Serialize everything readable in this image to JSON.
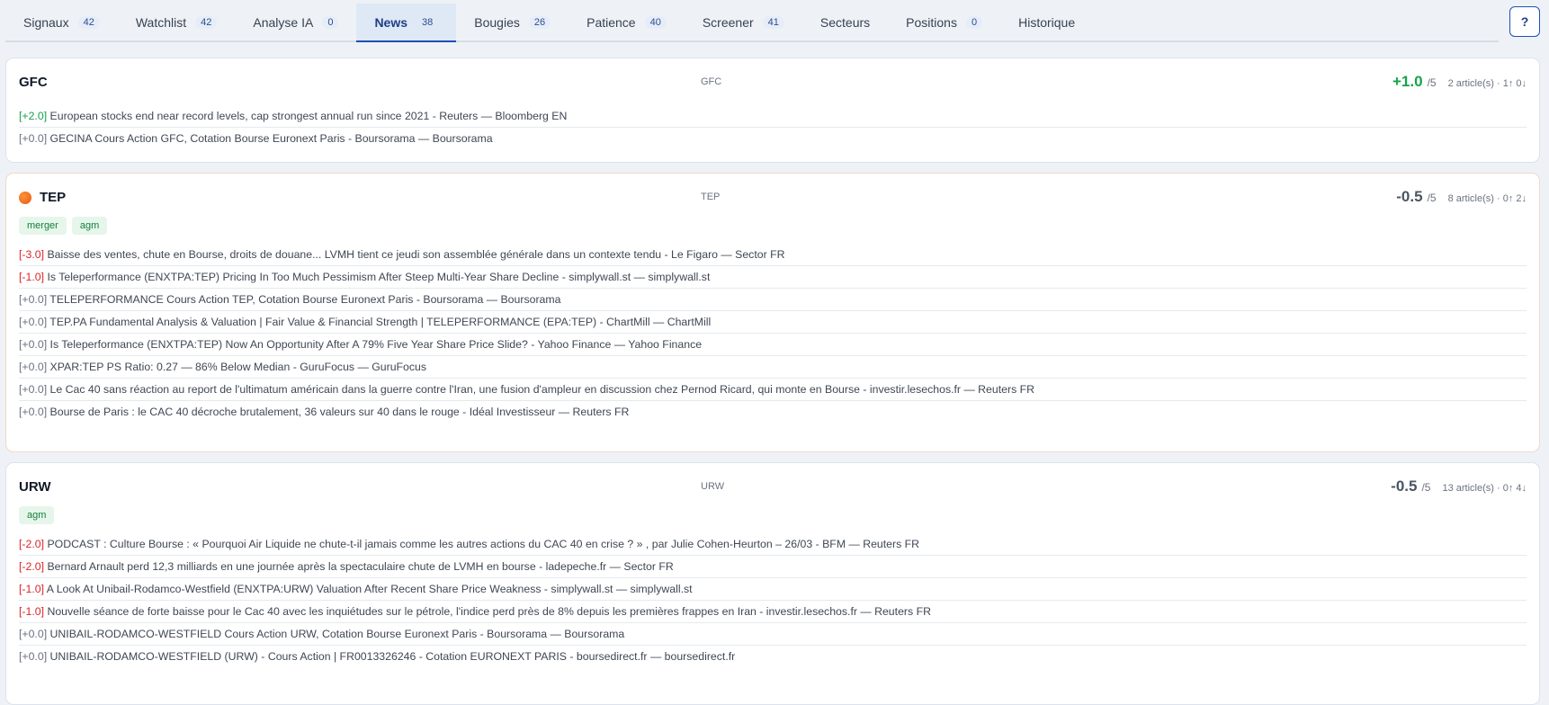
{
  "tabs": [
    {
      "label": "Signaux",
      "badge": "42"
    },
    {
      "label": "Watchlist",
      "badge": "42"
    },
    {
      "label": "Analyse IA",
      "badge": "0"
    },
    {
      "label": "News",
      "badge": "38"
    },
    {
      "label": "Bougies",
      "badge": "26"
    },
    {
      "label": "Patience",
      "badge": "40"
    },
    {
      "label": "Screener",
      "badge": "41"
    },
    {
      "label": "Secteurs",
      "badge": ""
    },
    {
      "label": "Positions",
      "badge": "0"
    },
    {
      "label": "Historique",
      "badge": ""
    }
  ],
  "active_tab": "News",
  "help_label": "?",
  "cards": [
    {
      "ticker": "GFC",
      "center": "GFC",
      "score": "+1.0",
      "score_max": "/5",
      "meta": "2 article(s) · 1↑ 0↓",
      "tags": [],
      "news": [
        {
          "score": "[+2.0]",
          "text": " European stocks end near record levels, cap strongest annual run since 2021 - Reuters — Bloomberg EN"
        },
        {
          "score": "[+0.0]",
          "text": " GECINA Cours Action GFC, Cotation Bourse Euronext Paris - Boursorama — Boursorama"
        }
      ]
    },
    {
      "ticker": "TEP",
      "center": "TEP",
      "score": "-0.5",
      "score_max": "/5",
      "meta": "8 article(s) · 0↑ 2↓",
      "tags": [
        "merger",
        "agm"
      ],
      "news": [
        {
          "score": "[-3.0]",
          "text": " Baisse des ventes, chute en Bourse, droits de douane... LVMH tient ce jeudi son assemblée générale dans un contexte tendu - Le Figaro — Sector FR"
        },
        {
          "score": "[-1.0]",
          "text": " Is Teleperformance (ENXTPA:TEP) Pricing In Too Much Pessimism After Steep Multi-Year Share Decline - simplywall.st — simplywall.st"
        },
        {
          "score": "[+0.0]",
          "text": " TELEPERFORMANCE Cours Action TEP, Cotation Bourse Euronext Paris - Boursorama — Boursorama"
        },
        {
          "score": "[+0.0]",
          "text": " TEP.PA Fundamental Analysis & Valuation | Fair Value & Financial Strength | TELEPERFORMANCE (EPA:TEP) - ChartMill — ChartMill"
        },
        {
          "score": "[+0.0]",
          "text": " Is Teleperformance (ENXTPA:TEP) Now An Opportunity After A 79% Five Year Share Price Slide? - Yahoo Finance — Yahoo Finance"
        },
        {
          "score": "[+0.0]",
          "text": " XPAR:TEP PS Ratio: 0.27 — 86% Below Median - GuruFocus — GuruFocus"
        },
        {
          "score": "[+0.0]",
          "text": " Le Cac 40 sans réaction au report de l'ultimatum américain dans la guerre contre l'Iran, une fusion d'ampleur en discussion chez Pernod Ricard, qui monte en Bourse - investir.lesechos.fr — Reuters FR"
        },
        {
          "score": "[+0.0]",
          "text": " Bourse de Paris : le CAC 40 décroche brutalement, 36 valeurs sur 40 dans le rouge - Idéal Investisseur — Reuters FR"
        }
      ]
    },
    {
      "ticker": "URW",
      "center": "URW",
      "score": "-0.5",
      "score_max": "/5",
      "meta": "13 article(s) · 0↑ 4↓",
      "tags": [
        "agm"
      ],
      "news": [
        {
          "score": "[-2.0]",
          "text": " PODCAST : Culture Bourse : « Pourquoi Air Liquide ne chute-t-il jamais comme les autres actions du CAC 40 en crise ? » , par Julie Cohen-Heurton – 26/03 - BFM — Reuters FR"
        },
        {
          "score": "[-2.0]",
          "text": " Bernard Arnault perd 12,3 milliards en une journée après la spectaculaire chute de LVMH en bourse - ladepeche.fr — Sector FR"
        },
        {
          "score": "[-1.0]",
          "text": " A Look At Unibail-Rodamco-Westfield (ENXTPA:URW) Valuation After Recent Share Price Weakness - simplywall.st — simplywall.st"
        },
        {
          "score": "[-1.0]",
          "text": " Nouvelle séance de forte baisse pour le Cac 40 avec les inquiétudes sur le pétrole, l'indice perd près de 8% depuis les premières frappes en Iran - investir.lesechos.fr — Reuters FR"
        },
        {
          "score": "[+0.0]",
          "text": " UNIBAIL-RODAMCO-WESTFIELD Cours Action URW, Cotation Bourse Euronext Paris - Boursorama — Boursorama"
        },
        {
          "score": "[+0.0]",
          "text": " UNIBAIL-RODAMCO-WESTFIELD (URW) - Cours Action | FR0013326246 - Cotation EURONEXT PARIS - boursedirect.fr — boursedirect.fr"
        }
      ]
    }
  ]
}
